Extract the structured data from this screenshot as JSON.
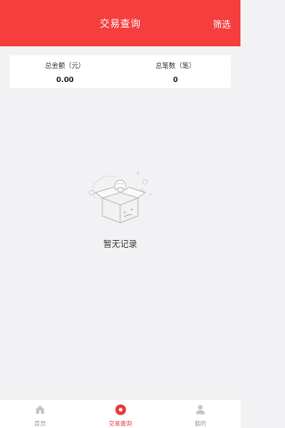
{
  "header": {
    "title": "交易查询",
    "filter_label": "筛选",
    "background_color": "#f53e3e"
  },
  "summary": {
    "total_amount_label": "总金额（元）",
    "total_amount_value": "0.00",
    "total_count_label": "总笔数（笔）",
    "total_count_value": "0"
  },
  "empty_state": {
    "icon": "empty-box-icon",
    "text": "暂无记录"
  },
  "tabbar": {
    "items": [
      {
        "label": "首页",
        "icon": "home-icon",
        "active": false
      },
      {
        "label": "交易查询",
        "icon": "record-dot-icon",
        "active": true
      },
      {
        "label": "我的",
        "icon": "user-icon",
        "active": false
      }
    ],
    "active_color": "#e8393a",
    "inactive_color": "#999999"
  }
}
